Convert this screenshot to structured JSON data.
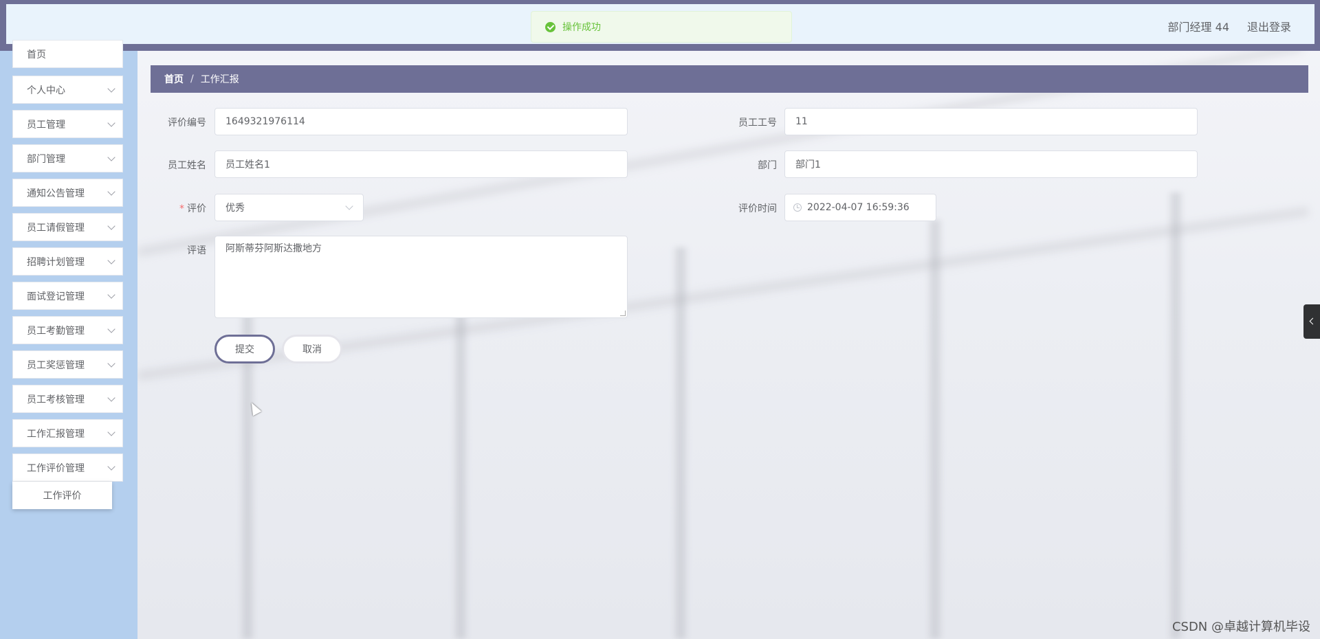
{
  "header": {
    "user_label": "部门经理 44",
    "logout_label": "退出登录"
  },
  "toast": {
    "message": "操作成功",
    "status_color": "#67c23a",
    "icon": "check-circle-icon"
  },
  "sidebar": {
    "items": [
      {
        "label": "首页"
      },
      {
        "label": "个人中心"
      },
      {
        "label": "员工管理"
      },
      {
        "label": "部门管理"
      },
      {
        "label": "通知公告管理"
      },
      {
        "label": "员工请假管理"
      },
      {
        "label": "招聘计划管理"
      },
      {
        "label": "面试登记管理"
      },
      {
        "label": "员工考勤管理"
      },
      {
        "label": "员工奖惩管理"
      },
      {
        "label": "员工考核管理"
      },
      {
        "label": "工作汇报管理"
      },
      {
        "label": "工作评价管理"
      }
    ],
    "submenu": {
      "label": "工作评价"
    }
  },
  "breadcrumb": {
    "home": "首页",
    "separator": "/",
    "current": "工作汇报"
  },
  "form": {
    "eval_no": {
      "label": "评价编号",
      "value": "1649321976114"
    },
    "staff_no": {
      "label": "员工工号",
      "value": "11"
    },
    "staff_name": {
      "label": "员工姓名",
      "value": "员工姓名1"
    },
    "dept": {
      "label": "部门",
      "value": "部门1"
    },
    "rating": {
      "label": "评价",
      "required_mark": "*",
      "value": "优秀"
    },
    "eval_time": {
      "label": "评价时间",
      "value": "2022-04-07 16:59:36"
    },
    "comment": {
      "label": "评语",
      "value": "阿斯蒂芬阿斯达撒地方"
    },
    "submit_label": "提交",
    "cancel_label": "取消"
  },
  "watermark": "CSDN @卓越计算机毕设",
  "colors": {
    "topbar": "#6e6f96",
    "sidebar": "#b4cfee",
    "breadcrumb": "#6e6f96"
  }
}
